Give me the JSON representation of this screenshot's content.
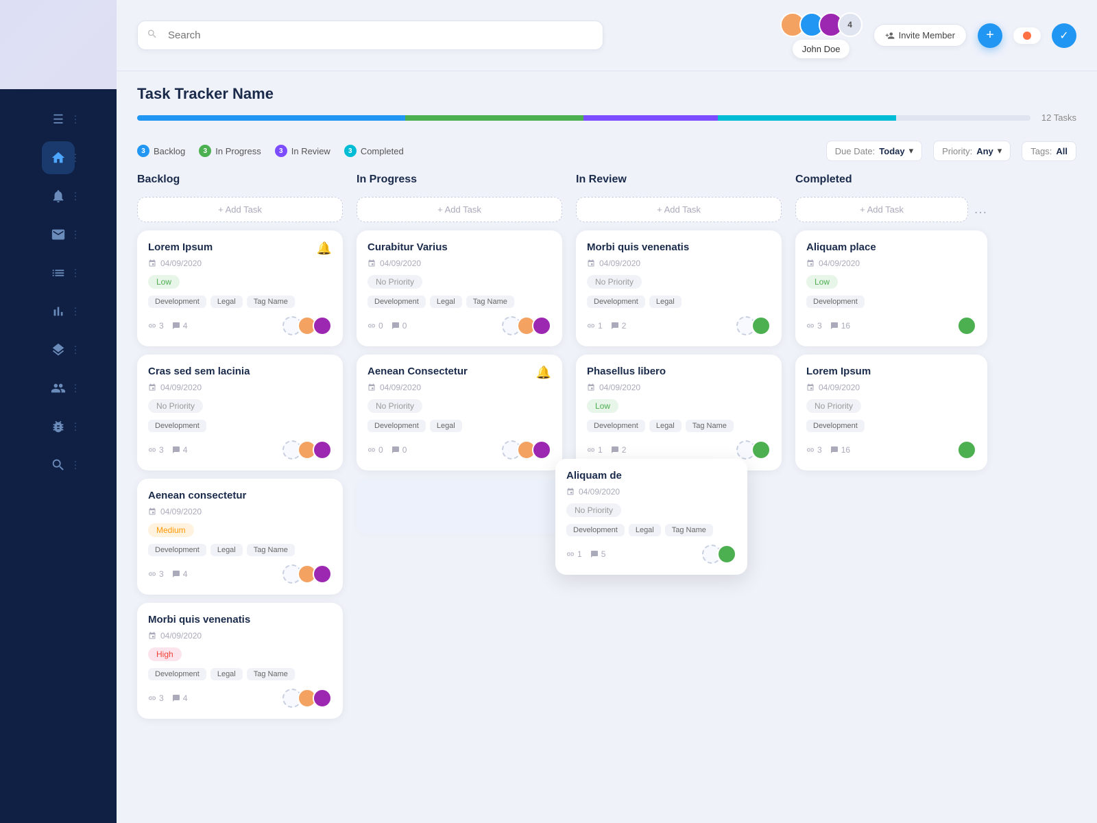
{
  "app": {
    "title": "Task Tracker Name",
    "search_placeholder": "Search"
  },
  "topbar": {
    "search_placeholder": "Search",
    "task_count": "12 Tasks",
    "invite_btn": "Invite Member",
    "user_label": "John Doe",
    "avatar_count": "4"
  },
  "progress": {
    "task_count": "12 Tasks",
    "segments": [
      {
        "color": "#2196f3",
        "width": "25%"
      },
      {
        "color": "#4caf50",
        "width": "20%"
      },
      {
        "color": "#9c27b0",
        "width": "15%"
      },
      {
        "color": "#00bcd4",
        "width": "20%"
      },
      {
        "color": "#e0e4f0",
        "width": "20%"
      }
    ]
  },
  "status_tabs": [
    {
      "label": "Backlog",
      "color": "#2196f3",
      "count": "3"
    },
    {
      "label": "In Progress",
      "color": "#4caf50",
      "count": "3"
    },
    {
      "label": "In Review",
      "color": "#9c27b0",
      "count": "3"
    },
    {
      "label": "Completed",
      "color": "#00bcd4",
      "count": "3"
    }
  ],
  "filters": {
    "due_date_label": "Due Date:",
    "due_date_value": "Today",
    "priority_label": "Priority:",
    "priority_value": "Any",
    "tags_label": "Tags:",
    "tags_value": "All"
  },
  "columns": [
    {
      "id": "backlog",
      "title": "Backlog",
      "add_task_label": "+ Add Task",
      "cards": [
        {
          "id": "b1",
          "title": "Lorem Ipsum",
          "date": "04/09/2020",
          "priority": "Low",
          "priority_type": "low",
          "tags": [
            "Development",
            "Legal",
            "Tag Name"
          ],
          "stats": {
            "links": "3",
            "comments": "4"
          },
          "has_bell": true
        },
        {
          "id": "b2",
          "title": "Cras sed sem lacinia",
          "date": "04/09/2020",
          "priority": "No Priority",
          "priority_type": "none",
          "tags": [
            "Development"
          ],
          "stats": {
            "links": "3",
            "comments": "4"
          },
          "has_bell": false
        },
        {
          "id": "b3",
          "title": "Aenean consectetur",
          "date": "04/09/2020",
          "priority": "Medium",
          "priority_type": "medium",
          "tags": [
            "Development",
            "Legal",
            "Tag Name"
          ],
          "stats": {
            "links": "3",
            "comments": "4"
          },
          "has_bell": false
        },
        {
          "id": "b4",
          "title": "Morbi quis venenatis",
          "date": "04/09/2020",
          "priority": "High",
          "priority_type": "high",
          "tags": [
            "Development",
            "Legal",
            "Tag Name"
          ],
          "stats": {
            "links": "3",
            "comments": "4"
          },
          "has_bell": false
        }
      ]
    },
    {
      "id": "inprogress",
      "title": "In Progress",
      "add_task_label": "+ Add Task",
      "cards": [
        {
          "id": "p1",
          "title": "Curabitur Varius",
          "date": "04/09/2020",
          "priority": "No Priority",
          "priority_type": "none",
          "tags": [
            "Development",
            "Legal",
            "Tag Name"
          ],
          "stats": {
            "links": "0",
            "comments": "0"
          },
          "has_bell": false
        },
        {
          "id": "p2",
          "title": "Aenean Consectetur",
          "date": "04/09/2020",
          "priority": "No Priority",
          "priority_type": "none",
          "tags": [
            "Development",
            "Legal"
          ],
          "stats": {
            "links": "0",
            "comments": "0"
          },
          "has_bell": true
        }
      ]
    },
    {
      "id": "inreview",
      "title": "In Review",
      "add_task_label": "+ Add Task",
      "cards": [
        {
          "id": "r1",
          "title": "Morbi quis venenatis",
          "date": "04/09/2020",
          "priority": "No Priority",
          "priority_type": "none",
          "tags": [
            "Development",
            "Legal"
          ],
          "stats": {
            "links": "1",
            "comments": "2"
          },
          "has_bell": false
        },
        {
          "id": "r2",
          "title": "Phasellus libero",
          "date": "04/09/2020",
          "priority": "Low",
          "priority_type": "low",
          "tags": [
            "Development",
            "Legal",
            "Tag Name"
          ],
          "stats": {
            "links": "1",
            "comments": "2"
          },
          "has_bell": false
        }
      ]
    },
    {
      "id": "completed",
      "title": "Completed",
      "add_task_label": "+ Add Task",
      "cards": [
        {
          "id": "c1",
          "title": "Aliquam place",
          "date": "04/09/2020",
          "priority": "Low",
          "priority_type": "low",
          "tags": [
            "Development"
          ],
          "stats": {
            "links": "3",
            "comments": "16"
          },
          "has_bell": false
        },
        {
          "id": "c2",
          "title": "Lorem Ipsum",
          "date": "04/09/2020",
          "priority": "No Priority",
          "priority_type": "none",
          "tags": [
            "Development"
          ],
          "stats": {
            "links": "3",
            "comments": "16"
          },
          "has_bell": false
        }
      ]
    }
  ],
  "floating_card": {
    "title": "Aliquam de",
    "date": "04/09/2020",
    "priority": "No Priority",
    "priority_type": "none",
    "tags": [
      "Development",
      "Legal",
      "Tag Name"
    ],
    "stats": {
      "links": "1",
      "comments": "5"
    }
  },
  "sidebar": {
    "icons": [
      {
        "name": "menu-icon",
        "symbol": "☰",
        "active": false
      },
      {
        "name": "home-icon",
        "symbol": "⌂",
        "active": true
      },
      {
        "name": "notification-icon",
        "symbol": "△",
        "active": false
      },
      {
        "name": "mail-icon",
        "symbol": "✉",
        "active": false
      },
      {
        "name": "list-icon",
        "symbol": "☰",
        "active": false
      },
      {
        "name": "chart-icon",
        "symbol": "▦",
        "active": false
      },
      {
        "name": "layers-icon",
        "symbol": "❑",
        "active": false
      },
      {
        "name": "team-icon",
        "symbol": "👥",
        "active": false
      },
      {
        "name": "bug-icon",
        "symbol": "✱",
        "active": false
      },
      {
        "name": "search-doc-icon",
        "symbol": "🔍",
        "active": false
      }
    ]
  },
  "avatars": {
    "colors": [
      "#f4a261",
      "#2196f3",
      "#9c27b0",
      "#4caf50",
      "#ff5722"
    ]
  }
}
